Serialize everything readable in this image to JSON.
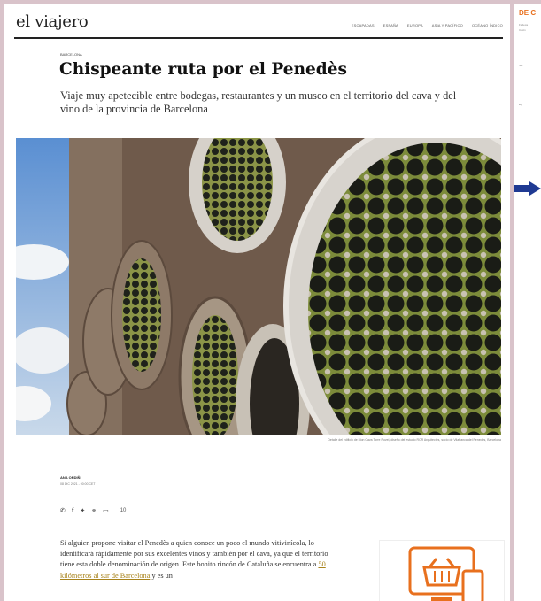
{
  "site": {
    "logo": "el viajero",
    "nav": [
      "ESCAPADAS",
      "ESPAÑA",
      "EUROPA",
      "ASIA Y PACÍFICO",
      "OCÉANO ÍNDICO"
    ]
  },
  "article": {
    "kicker": "BARCELONA",
    "headline": "Chispeante ruta por el Penedès",
    "dek": "Viaje muy apetecible entre bodegas, restaurantes y un museo en el territorio del cava y del vino de la provincia de Barcelona",
    "caption": "Detalle del edificio de Mon Cava Torre Rovel, diseño del estudio RCR Arquitectes, socio de Vilafranca del Penedès, Barcelona",
    "author": "ANA ORDIÑ",
    "date": "08 DIC 2021 - 00:00 CET",
    "comment_count": "10",
    "body_before_link": "Si alguien propone visitar el Penedès a quien conoce un poco el mundo vitivinícola, lo identificará rápidamente por sus excelentes vinos y también por el cava, ya que el territorio tiene esta doble denominación de origen. Este bonito rincón de Cataluña se encuentra a ",
    "body_link": "50 kilómetros al sur de Barcelona",
    "body_after_link": " y es un"
  },
  "share_icons": [
    "whatsapp-icon",
    "facebook-icon",
    "twitter-icon",
    "link-icon",
    "comment-icon"
  ],
  "sidebar": {
    "logo": "DE C",
    "lines": [
      "Fadeca",
      "Cocin",
      "Sal",
      "Ep"
    ]
  },
  "colors": {
    "accent": "#a8831c",
    "ad_orange": "#e8701e",
    "sidebar_arrow": "#1f3a93",
    "frame": "#d9c3ca"
  }
}
